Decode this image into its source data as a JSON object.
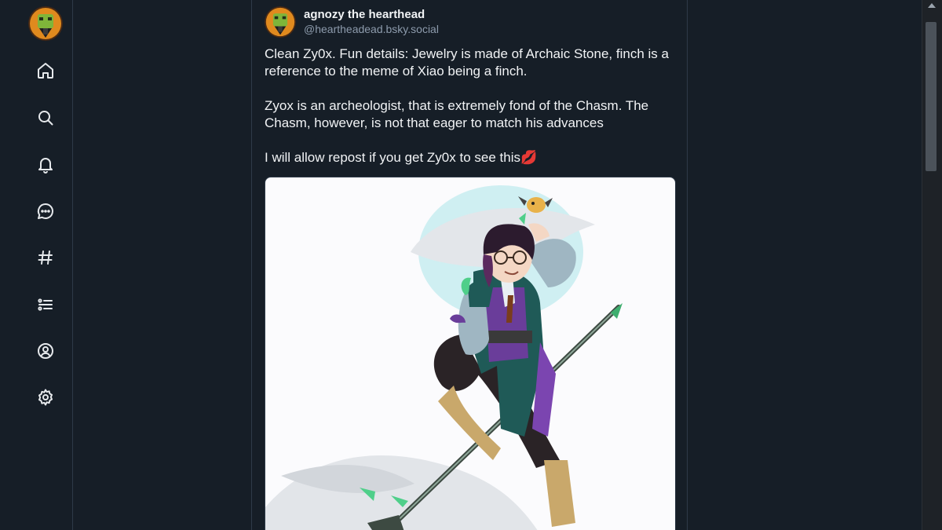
{
  "nav": {
    "items": [
      {
        "name": "home",
        "icon": "home-icon"
      },
      {
        "name": "search",
        "icon": "search-icon"
      },
      {
        "name": "notifications",
        "icon": "bell-icon"
      },
      {
        "name": "chat",
        "icon": "chat-icon"
      },
      {
        "name": "feeds",
        "icon": "hash-icon"
      },
      {
        "name": "lists",
        "icon": "list-icon"
      },
      {
        "name": "profile",
        "icon": "user-circle-icon"
      },
      {
        "name": "settings",
        "icon": "gear-icon"
      }
    ]
  },
  "post": {
    "author": {
      "display_name": "agnozy the hearthead",
      "handle": "@heartheadead.bsky.social"
    },
    "paragraphs": [
      "Clean Zy0x. Fun details: Jewelry is made of Archaic Stone, finch is a reference to the meme of Xiao being a finch.",
      "Zyox is an archeologist, that is extremely fond of the Chasm. The Chasm, however, is not that eager to match his advances",
      "I will allow repost if you get Zy0x to see this"
    ],
    "emoji": "💋"
  },
  "colors": {
    "background": "#161e27",
    "border": "#2e3a48",
    "text": "#f1f3f5",
    "muted": "#8d9bac",
    "accent_purple": "#6a3d9a",
    "accent_teal": "#2e6e6a",
    "accent_green": "#4fcf8a"
  }
}
